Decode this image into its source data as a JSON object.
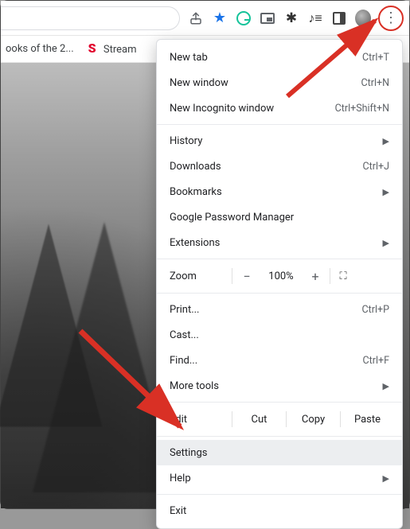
{
  "toolbar": {
    "share_icon": "share-icon",
    "star_icon": "star-icon",
    "grammarly_icon": "grammarly-icon",
    "pip_icon": "picture-in-picture-icon",
    "extensions_icon": "extensions-puzzle-icon",
    "music_icon": "media-controls-icon",
    "sidepanel_icon": "side-panel-icon",
    "avatar_icon": "profile-avatar-icon",
    "more_icon": "more-vert-icon"
  },
  "bookmarks": {
    "item1": "ooks of the 2...",
    "item2": "Stream"
  },
  "menu": {
    "new_tab": {
      "label": "New tab",
      "shortcut": "Ctrl+T"
    },
    "new_window": {
      "label": "New window",
      "shortcut": "Ctrl+N"
    },
    "incognito": {
      "label": "New Incognito window",
      "shortcut": "Ctrl+Shift+N"
    },
    "history": {
      "label": "History"
    },
    "downloads": {
      "label": "Downloads",
      "shortcut": "Ctrl+J"
    },
    "bookmarks_item": {
      "label": "Bookmarks"
    },
    "passwords": {
      "label": "Google Password Manager"
    },
    "extensions": {
      "label": "Extensions"
    },
    "zoom": {
      "label": "Zoom",
      "value": "100%",
      "minus": "−",
      "plus": "+",
      "fullscreen": "⛶"
    },
    "print": {
      "label": "Print...",
      "shortcut": "Ctrl+P"
    },
    "cast": {
      "label": "Cast..."
    },
    "find": {
      "label": "Find...",
      "shortcut": "Ctrl+F"
    },
    "more_tools": {
      "label": "More tools"
    },
    "edit": {
      "label": "Edit",
      "cut": "Cut",
      "copy": "Copy",
      "paste": "Paste"
    },
    "settings": {
      "label": "Settings"
    },
    "help": {
      "label": "Help"
    },
    "exit": {
      "label": "Exit"
    }
  }
}
